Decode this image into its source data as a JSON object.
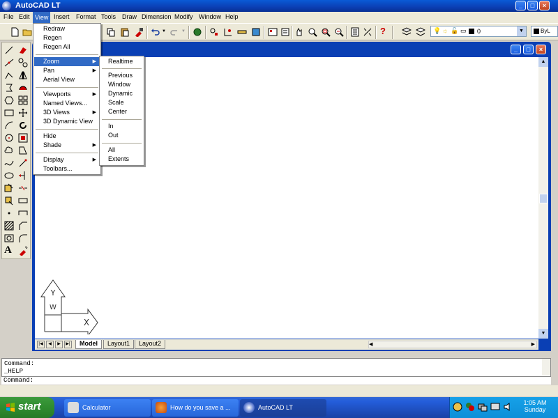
{
  "window": {
    "title": "AutoCAD LT"
  },
  "menubar": [
    "File",
    "Edit",
    "View",
    "Insert",
    "Format",
    "Tools",
    "Draw",
    "Dimension",
    "Modify",
    "Window",
    "Help"
  ],
  "view_menu": {
    "groups": [
      [
        "Redraw",
        "Regen",
        "Regen All"
      ],
      [
        "Zoom",
        "Pan",
        "Aerial View"
      ],
      [
        "Viewports",
        "Named Views...",
        "3D Views",
        "3D Dynamic View"
      ],
      [
        "Hide",
        "Shade"
      ],
      [
        "Display",
        "Toolbars..."
      ]
    ]
  },
  "zoom_submenu": {
    "groups": [
      [
        "Realtime"
      ],
      [
        "Previous",
        "Window",
        "Dynamic",
        "Scale",
        "Center"
      ],
      [
        "In",
        "Out"
      ],
      [
        "All",
        "Extents"
      ]
    ]
  },
  "layer_combo": {
    "value": "0"
  },
  "color_combo": {
    "value": "ByL"
  },
  "layout_tabs": [
    "Model",
    "Layout1",
    "Layout2"
  ],
  "ucs": {
    "y_label": "Y",
    "w_label": "W",
    "x_label": "X"
  },
  "command": {
    "lines": [
      "Command:",
      "_HELP"
    ],
    "prompt": "Command:"
  },
  "taskbar": {
    "start": "start",
    "tasks": [
      "Calculator",
      "How do you save a ...",
      "AutoCAD LT"
    ],
    "time": "1:05 AM",
    "day": "Sunday"
  },
  "colors": {
    "accent": "#316ac5",
    "titlebar": "#0b3fb4",
    "taskbar": "#245edb"
  }
}
